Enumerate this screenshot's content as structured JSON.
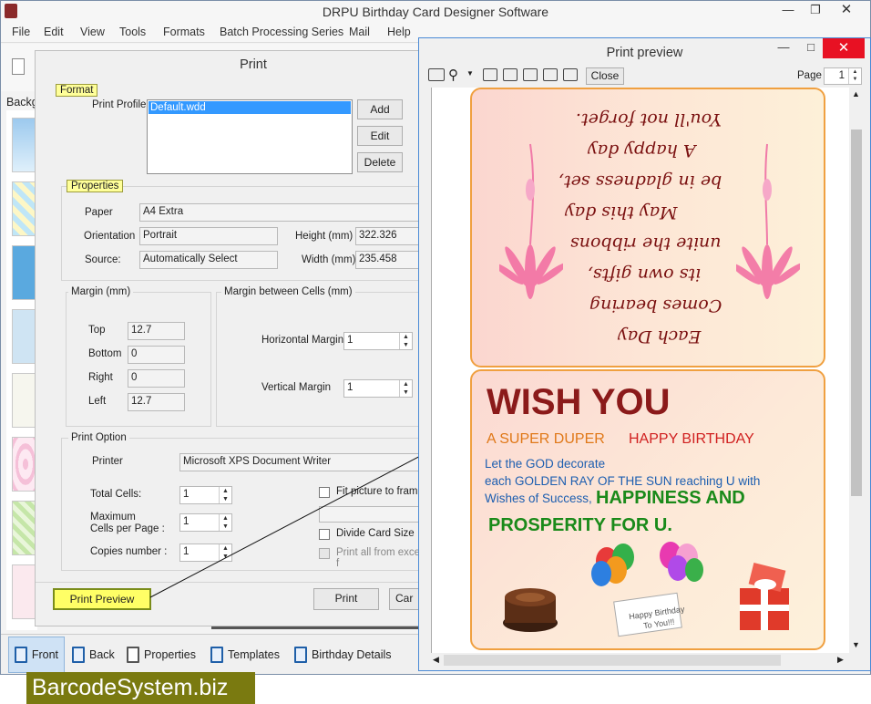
{
  "app": {
    "title": "DRPU Birthday Card Designer Software",
    "menu": [
      "File",
      "Edit",
      "View",
      "Tools",
      "Formats",
      "Batch Processing Series",
      "Mail",
      "Help"
    ],
    "sidebar_label": "Backg",
    "bottom_tabs": [
      "Front",
      "Back",
      "Properties",
      "Templates",
      "Birthday Details"
    ]
  },
  "print_dialog": {
    "title": "Print",
    "format_label": "Format",
    "print_profile_label": "Print Profile",
    "print_profile_selected": "Default.wdd",
    "add_label": "Add",
    "edit_label": "Edit",
    "delete_label": "Delete",
    "properties_label": "Properties",
    "paper_label": "Paper",
    "paper_value": "A4 Extra",
    "orientation_label": "Orientation",
    "orientation_value": "Portrait",
    "height_label": "Height (mm)",
    "height_value": "322.326",
    "source_label": "Source:",
    "source_value": "Automatically Select",
    "width_label": "Width (mm)",
    "width_value": "235.458",
    "margin_label": "Margin (mm)",
    "top_label": "Top",
    "top_value": "12.7",
    "bottom_label": "Bottom",
    "bottom_value": "0",
    "right_label": "Right",
    "right_value": "0",
    "left_label": "Left",
    "left_value": "12.7",
    "cells_margin_label": "Margin between Cells (mm)",
    "h_margin_label": "Horizontal Margin",
    "h_margin_value": "1",
    "v_margin_label": "Vertical Margin",
    "v_margin_value": "1",
    "print_option_label": "Print Option",
    "printer_label": "Printer",
    "printer_value": "Microsoft XPS Document Writer",
    "total_cells_label": "Total Cells:",
    "total_cells_value": "1",
    "max_cells_label_1": "Maximum",
    "max_cells_label_2": "Cells per Page :",
    "max_cells_value": "1",
    "copies_label": "Copies number :",
    "copies_value": "1",
    "fit_picture_label": "Fit picture to frame",
    "divide_card_label": "Divide Card Size",
    "print_all_label": "Print all from excel f",
    "print_preview_label": "Print Preview",
    "print_label": "Print",
    "cancel_label": "Car"
  },
  "preview_window": {
    "title": "Print preview",
    "close_label": "Close",
    "page_label": "Page",
    "page_value": "1"
  },
  "card": {
    "verse_lines": [
      "You'll not forget.",
      "A happy day",
      "be in gladness set,",
      "May this day",
      "unite the ribbons",
      "its own gifts,",
      "Comes bearing",
      "Each Day"
    ],
    "headline": "WISH YOU",
    "super_duper": "A SUPER DUPER",
    "happy_birthday": "HAPPY BIRTHDAY",
    "line1": "Let the GOD decorate",
    "line2": "each GOLDEN RAY OF THE SUN reaching U with",
    "line3a": "Wishes of Success,",
    "line3b": "HAPPINESS AND",
    "line4": "PROSPERITY FOR U.",
    "tag_line1": "Happy Birthday",
    "tag_line2": "To You!!!",
    "colors": {
      "headline": "#8b1a1a",
      "orange": "#e07818",
      "red": "#d02020",
      "blue": "#1c5eb0",
      "green": "#1a8a1a"
    }
  },
  "footer": {
    "badge": "BarcodeSystem.biz"
  }
}
